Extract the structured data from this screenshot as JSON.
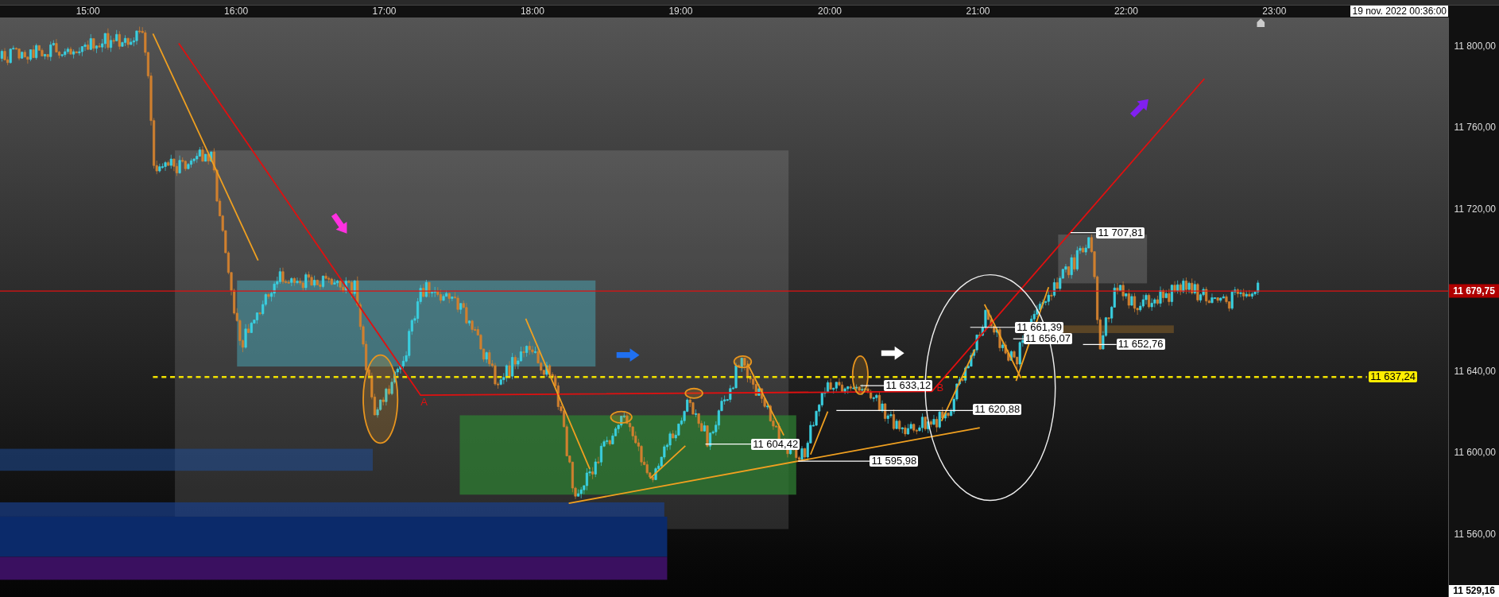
{
  "time_axis": {
    "labels": [
      "15:00",
      "16:00",
      "17:00",
      "18:00",
      "19:00",
      "20:00",
      "21:00",
      "22:00",
      "23:00"
    ],
    "cursor_time": "19 nov. 2022 00:36:00"
  },
  "price_axis": {
    "ticks": [
      "11 800,00",
      "11 760,00",
      "11 720,00",
      "11 640,00",
      "11 600,00",
      "11 560,00"
    ],
    "last_price": "11 679,75",
    "low_price": "11 529,16"
  },
  "chart": {
    "level_label": "11 637,24",
    "point_labels": [
      "A",
      "B"
    ],
    "price_labels": [
      "11 707,81",
      "11 661,39",
      "11 656,07",
      "11 652,76",
      "11 633,12",
      "11 620,88",
      "11 604,42",
      "11 595,98"
    ]
  }
}
